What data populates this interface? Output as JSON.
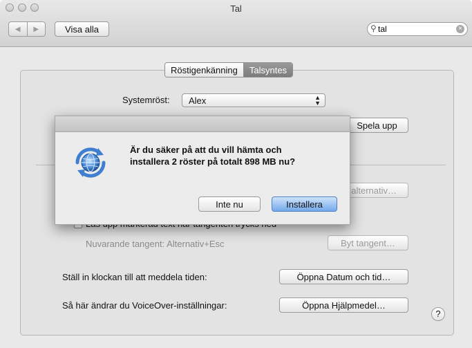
{
  "window": {
    "title": "Tal"
  },
  "toolbar": {
    "back_symbol": "◀",
    "forward_symbol": "▶",
    "show_all_label": "Visa alla"
  },
  "search": {
    "value": "tal",
    "icon": "magnifier-icon",
    "clear_symbol": "×"
  },
  "tabs": [
    {
      "label": "Röstigenkänning",
      "selected": false
    },
    {
      "label": "Talsyntes",
      "selected": true
    }
  ],
  "speech": {
    "system_voice_label": "Systemröst:",
    "system_voice_value": "Alex",
    "play_button": "Spela upp",
    "options_button_partial": "alternativ…",
    "read_selected_label": "Läs upp markerad text när tangenten trycks ned",
    "current_key_label": "Nuvarande tangent: Alternativ+Esc",
    "change_key_button": "Byt tangent…",
    "clock_label": "Ställ in klockan till att meddela tiden:",
    "date_time_button": "Öppna Datum och tid…",
    "voiceover_label": "Så här ändrar du VoiceOver-inställningar:",
    "accessibility_button": "Öppna Hjälpmedel…",
    "help_symbol": "?"
  },
  "dialog": {
    "message_line1": "Är du säker på att du vill hämta och",
    "message_line2": "installera 2 röster på totalt 898 MB nu?",
    "cancel_button": "Inte nu",
    "confirm_button": "Installera",
    "icon": "software-update-icon"
  },
  "colors": {
    "accent": "#5b93de",
    "icon_blue": "#3f7fd0"
  }
}
